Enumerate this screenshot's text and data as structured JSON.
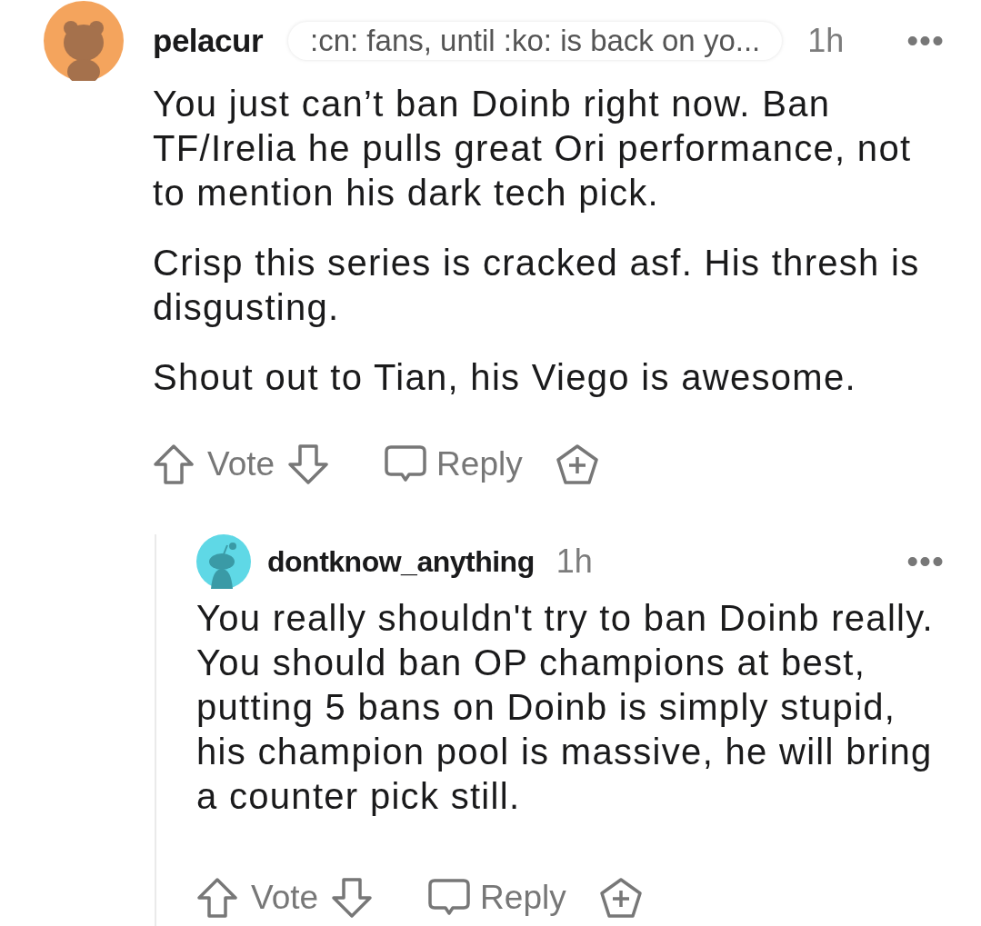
{
  "comments": [
    {
      "avatar": {
        "kind": "bear"
      },
      "username": "pelacur",
      "flair": ":cn: fans, until :ko: is back on yo...",
      "time": "1h",
      "more": "•••",
      "paragraphs": [
        "You just can’t ban Doinb right now. Ban TF/Irelia he pulls great Ori performance, not to mention his dark tech pick.",
        "Crisp this series is cracked asf. His thresh is disgusting.",
        "Shout out to Tian, his Viego is awesome."
      ],
      "vote": "Vote",
      "reply": "Reply",
      "replies": [
        {
          "avatar": {
            "kind": "snoo"
          },
          "username": "dontknow_anything",
          "time": "1h",
          "more": "•••",
          "paragraphs": [
            "You really shouldn't try to ban Doinb really. You should ban OP champions at best, putting 5 bans on Doinb is simply stupid, his champion pool is massive, he will bring a counter pick still."
          ],
          "vote": "Vote",
          "reply": "Reply"
        }
      ]
    }
  ]
}
